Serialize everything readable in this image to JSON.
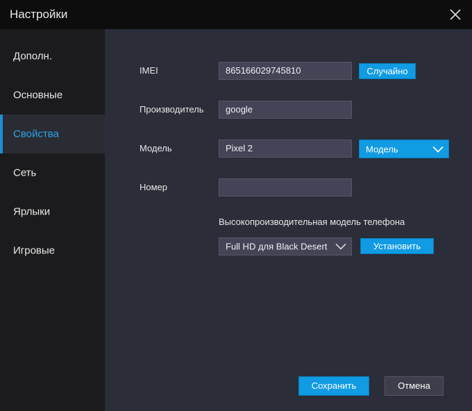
{
  "window": {
    "title": "Настройки"
  },
  "sidebar": {
    "items": [
      {
        "label": "Дополн."
      },
      {
        "label": "Основные"
      },
      {
        "label": "Свойства",
        "active": true
      },
      {
        "label": "Сеть"
      },
      {
        "label": "Ярлыки"
      },
      {
        "label": "Игровые"
      }
    ]
  },
  "form": {
    "imei": {
      "label": "IMEI",
      "value": "865166029745810",
      "random_button": "Случайно"
    },
    "manufacturer": {
      "label": "Производитель",
      "value": "google"
    },
    "model": {
      "label": "Модель",
      "value": "Pixel 2",
      "dropdown_value": "Модель"
    },
    "number": {
      "label": "Номер",
      "value": ""
    },
    "high_perf": {
      "heading": "Высокопроизводительная модель телефона",
      "selected": "Full HD для Black Desert",
      "install_button": "Установить"
    }
  },
  "footer": {
    "save": "Сохранить",
    "cancel": "Отмена"
  },
  "colors": {
    "accent": "#109be3",
    "active_nav_text": "#2ea3e6",
    "panel": "#2b2d38",
    "sidebar": "#1b1b1d"
  },
  "icons": {
    "close": "close-icon",
    "chevron": "chevron-down-icon"
  }
}
